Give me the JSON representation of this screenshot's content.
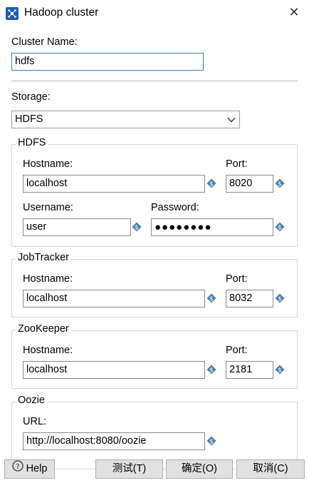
{
  "window": {
    "title": "Hadoop cluster"
  },
  "cluster_name": {
    "label": "Cluster Name:",
    "value": "hdfs"
  },
  "storage": {
    "label": "Storage:",
    "selected": "HDFS"
  },
  "hdfs": {
    "legend": "HDFS",
    "hostname_label": "Hostname:",
    "hostname": "localhost",
    "port_label": "Port:",
    "port": "8020",
    "username_label": "Username:",
    "username": "user",
    "password_label": "Password:",
    "password_mask": "●●●●●●●●"
  },
  "jobtracker": {
    "legend": "JobTracker",
    "hostname_label": "Hostname:",
    "hostname": "localhost",
    "port_label": "Port:",
    "port": "8032"
  },
  "zookeeper": {
    "legend": "ZooKeeper",
    "hostname_label": "Hostname:",
    "hostname": "localhost",
    "port_label": "Port:",
    "port": "2181"
  },
  "oozie": {
    "legend": "Oozie",
    "url_label": "URL:",
    "url": "http://localhost:8080/oozie"
  },
  "buttons": {
    "help": "Help",
    "test": "测试(T)",
    "ok": "确定(O)",
    "cancel": "取消(C)"
  },
  "icons": {
    "app": "hadoop-cluster-icon",
    "close": "close-icon",
    "variable": "variable-diamond-icon",
    "help": "help-circle-icon",
    "dropdown": "chevron-down-icon"
  },
  "colors": {
    "accent_border": "#2f7fbf",
    "button_bg": "#e1e1e1",
    "app_icon": "#1a5fb4"
  }
}
